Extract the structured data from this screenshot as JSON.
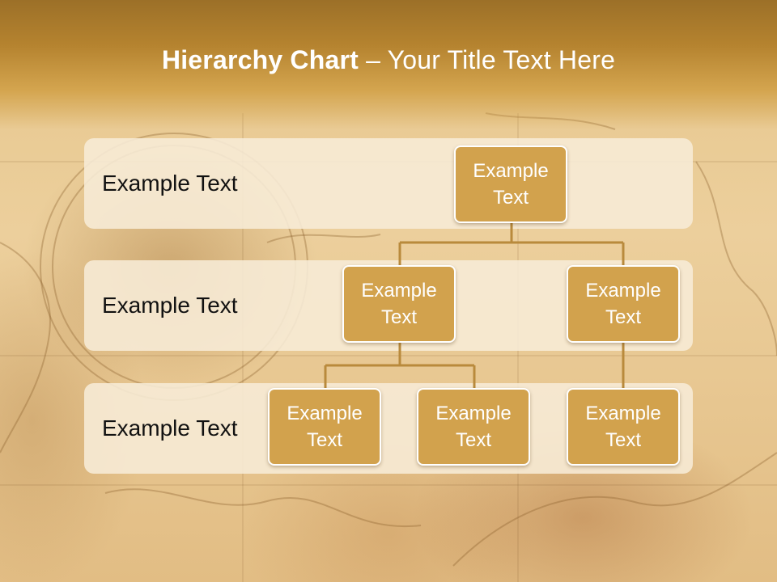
{
  "slide": {
    "title_bold": "Hierarchy Chart",
    "title_rest": " – Your Title Text Here"
  },
  "levels": [
    {
      "label": "Example Text"
    },
    {
      "label": "Example Text"
    },
    {
      "label": "Example Text"
    }
  ],
  "nodes": [
    {
      "text": "Example Text"
    },
    {
      "text": "Example Text"
    },
    {
      "text": "Example Text"
    },
    {
      "text": "Example Text"
    },
    {
      "text": "Example Text"
    },
    {
      "text": "Example Text"
    }
  ],
  "colors": {
    "node_fill": "#d2a24d",
    "node_border": "#ffffff",
    "connector": "#b98a3c",
    "band": "#f7ecd7",
    "header": "#b5832f"
  }
}
